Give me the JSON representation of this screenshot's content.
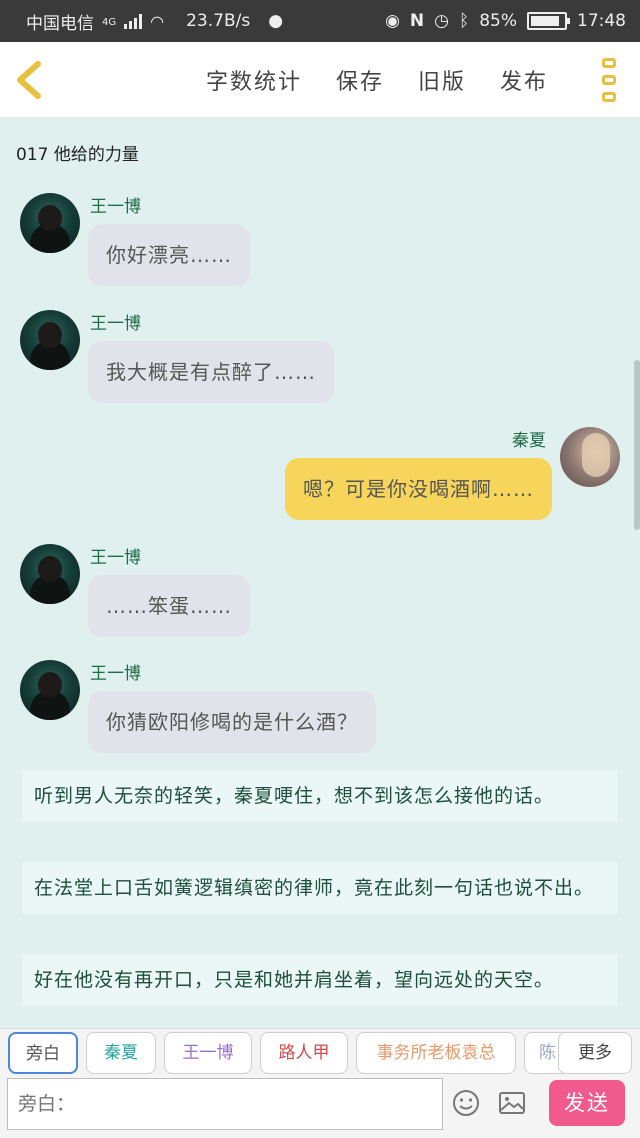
{
  "status": {
    "carrier": "中国电信",
    "network": "4G",
    "speed": "23.7B/s",
    "battery": "85%",
    "time": "17:48"
  },
  "toolbar": {
    "word_count": "字数统计",
    "save": "保存",
    "old_version": "旧版",
    "publish": "发布"
  },
  "chapter_title": "017  他给的力量",
  "messages": [
    {
      "name": "王一博",
      "text": "你好漂亮……"
    },
    {
      "name": "王一博",
      "text": "我大概是有点醉了……"
    },
    {
      "name": "秦夏",
      "text": "嗯？可是你没喝酒啊……"
    },
    {
      "name": "王一博",
      "text": "……笨蛋……"
    },
    {
      "name": "王一博",
      "text": "你猜欧阳修喝的是什么酒？"
    }
  ],
  "narrations": [
    "听到男人无奈的轻笑，秦夏哽住，想不到该怎么接他的话。",
    "在法堂上口舌如簧逻辑缜密的律师，竟在此刻一句话也说不出。",
    "好在他没有再开口，只是和她并肩坐着，望向远处的天空。"
  ],
  "roles": [
    {
      "label": "旁白",
      "color": "#555555"
    },
    {
      "label": "秦夏",
      "color": "#2aa5a0"
    },
    {
      "label": "王一博",
      "color": "#9b6fd0"
    },
    {
      "label": "路人甲",
      "color": "#d44b4b"
    },
    {
      "label": "事务所老板袁总",
      "color": "#e89a6a"
    },
    {
      "label": "陈",
      "color": "#9aa7c4"
    }
  ],
  "more_label": "更多",
  "input": {
    "placeholder": "旁白："
  },
  "send_label": "发送",
  "colors": {
    "accent_yellow": "#f7d55b",
    "send_pink": "#f05a8c",
    "background": "#dff0ee"
  }
}
